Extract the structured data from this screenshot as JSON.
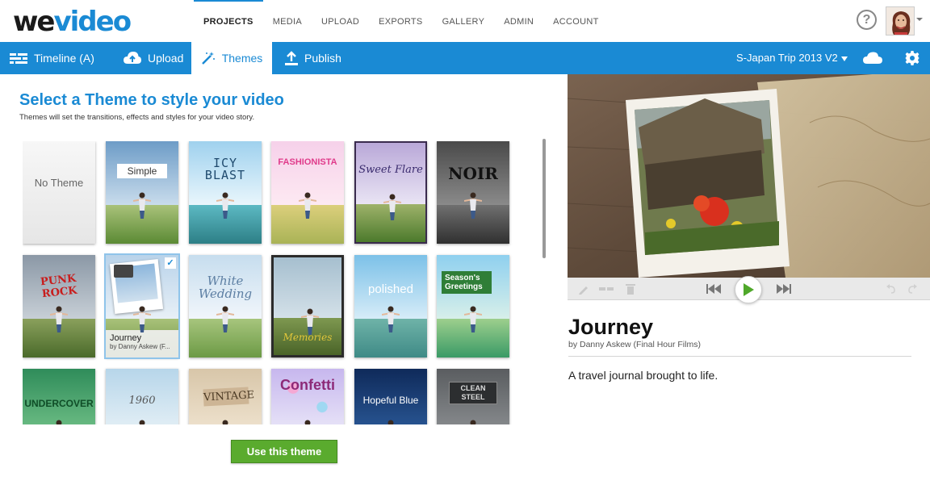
{
  "app": {
    "logo_we": "we",
    "logo_video": "video"
  },
  "nav": {
    "items": [
      "PROJECTS",
      "MEDIA",
      "UPLOAD",
      "EXPORTS",
      "GALLERY",
      "ADMIN",
      "ACCOUNT"
    ],
    "active": "PROJECTS"
  },
  "header_icons": {
    "help": "?",
    "help_icon": "help-circle-icon",
    "avatar_icon": "user-avatar"
  },
  "toolbar": {
    "timeline_label": "Timeline (A)",
    "upload_label": "Upload",
    "themes_label": "Themes",
    "publish_label": "Publish",
    "project_title": "S-Japan Trip 2013 V2",
    "active_tab": "Themes",
    "cloud_icon": "cloud-icon",
    "settings_icon": "gear-icon"
  },
  "themes_panel": {
    "heading": "Select a Theme to style your video",
    "subheading": "Themes will set the transitions, effects and styles for your video story.",
    "use_button": "Use this theme",
    "themes": [
      {
        "name": "No Theme",
        "label": "No Theme"
      },
      {
        "name": "Simple",
        "label": "Simple"
      },
      {
        "name": "Icy Blast",
        "label": "ICY BLAST"
      },
      {
        "name": "Fashionista",
        "label": "FASHIONISTA"
      },
      {
        "name": "Sweet Flare",
        "label": "Sweet Flare"
      },
      {
        "name": "Noir",
        "label": "NOIR"
      },
      {
        "name": "Punk Rock",
        "label": "PUNK ROCK"
      },
      {
        "name": "Journey",
        "label": "Journey",
        "author": "by Danny Askew (F...",
        "selected": true
      },
      {
        "name": "White Wedding",
        "label": "White Wedding"
      },
      {
        "name": "Memories",
        "label": "Memories"
      },
      {
        "name": "Polished",
        "label": "polished"
      },
      {
        "name": "Season's Greetings",
        "label": "Season's Greetings"
      },
      {
        "name": "Undercover",
        "label": "UNDERCOVER"
      },
      {
        "name": "1960",
        "label": "1960"
      },
      {
        "name": "Vintage",
        "label": "VINTAGE"
      },
      {
        "name": "Confetti",
        "label": "Confetti"
      },
      {
        "name": "Hopeful Blue",
        "label": "Hopeful Blue"
      },
      {
        "name": "Clean Steel",
        "label": "CLEAN STEEL"
      }
    ]
  },
  "preview": {
    "title": "Journey",
    "author": "by Danny Askew (Final Hour Films)",
    "description": "A travel journal brought to life."
  },
  "colors": {
    "brand_blue": "#1a8ad4",
    "button_green": "#5aab2e"
  }
}
